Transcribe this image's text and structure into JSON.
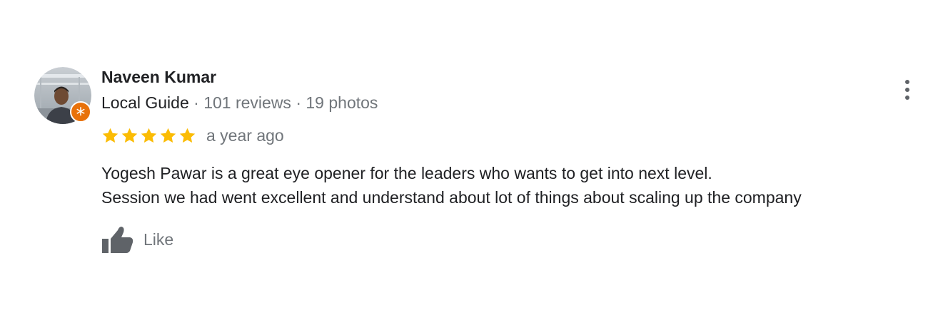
{
  "reviewer": {
    "name": "Naveen Kumar",
    "badge_icon": "local-guide-star-icon",
    "guide_label": "Local Guide",
    "separator": " · ",
    "reviews": "101 reviews",
    "photos": "19 photos"
  },
  "rating": {
    "stars": 5,
    "max": 5,
    "star_color": "#fbbc04",
    "time": "a year ago"
  },
  "review_text": {
    "line1": "Yogesh Pawar is a great eye opener for the leaders who wants to get into next level.",
    "line2": "Session we had went excellent and understand about lot of things about scaling up the company"
  },
  "actions": {
    "like_label": "Like",
    "like_icon": "thumb-up-icon",
    "more_icon": "more-vert-icon"
  },
  "colors": {
    "text": "#202124",
    "secondary": "#70757a",
    "badge": "#e8710a",
    "icon": "#5f6368"
  }
}
